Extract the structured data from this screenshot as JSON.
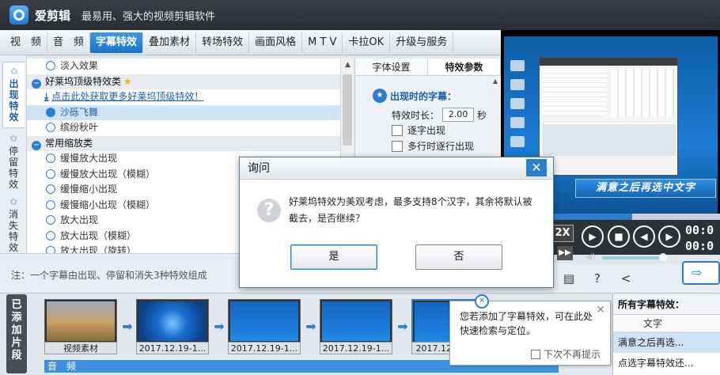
{
  "app": {
    "name": "爱剪辑",
    "slogan": "最易用、强大的视频剪辑软件"
  },
  "tabs": [
    "视　频",
    "音　频",
    "字幕特效",
    "叠加素材",
    "转场特效",
    "画面风格",
    "M T V",
    "卡拉OK",
    "升级与服务"
  ],
  "side_tabs": [
    {
      "label": "出\n现\n特\n效",
      "icon": "star-icon"
    },
    {
      "label": "停\n留\n特\n效",
      "icon": "star-icon"
    },
    {
      "label": "消\n失\n特\n效",
      "icon": "star-icon"
    }
  ],
  "effects_list": {
    "item_fade_in": "淡入效果",
    "group_hollywood": "好莱坞顶级特效类",
    "download_link": "点击此处获取更多好莱坞顶级特效！",
    "item_sand": "沙砾飞舞",
    "item_colorful": "缤纷秋叶",
    "group_zoom": "常用缩放类",
    "zoom_items": [
      "缓慢放大出现",
      "缓慢放大出现（模糊）",
      "缓慢缩小出现",
      "缓慢缩小出现（模糊）",
      "放大出现",
      "放大出现（模糊）",
      "放大出现（旋转）"
    ]
  },
  "settings": {
    "tab_font": "字体设置",
    "tab_effect": "特效参数",
    "appear_title": "出现时的字幕：",
    "duration_label": "特效时长：",
    "duration_value": "2.00",
    "duration_unit": "秒",
    "char_by_char": "逐字出现",
    "multi_line": "多行时逐行出现"
  },
  "preview": {
    "subtitle_text": "满意之后再选中文字",
    "speed": "2X",
    "timecode_1": "00:0",
    "timecode_2": "00:0",
    "progress": 0.6
  },
  "note": "注：一个字幕由出现、停留和消失3种特效组成",
  "timeline": {
    "label": "已\n添\n加\n片\n段",
    "clips": [
      "视频素材",
      "2017.12.19-1...",
      "2017.12.19-1...",
      "2017.12.19-1...",
      "2017.12."
    ],
    "audio_label": "音　频"
  },
  "tooltip": {
    "text": "您若添加了字幕特效，可在此处快速检索与定位。",
    "no_show": "下次不再提示"
  },
  "effects_panel": {
    "title": "所有字幕特效：",
    "col_text": "文字",
    "rows": [
      "满意之后再选...",
      "点选字幕特效还..."
    ]
  },
  "dialog": {
    "title": "询问",
    "message": "好莱坞特效为美观考虑，最多支持8个汉字，其余将默认被截去，是否继续？",
    "yes": "是",
    "no": "否"
  },
  "colors": {
    "accent": "#2b7fd1",
    "titlebar": "#2f343a"
  }
}
